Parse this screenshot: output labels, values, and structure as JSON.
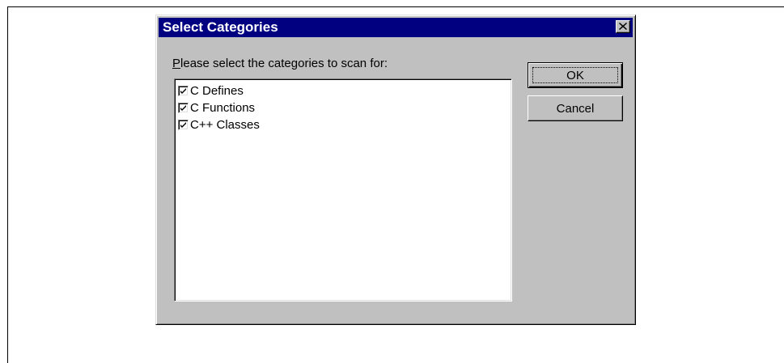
{
  "dialog": {
    "title": "Select Categories",
    "prompt": {
      "mnemonic": "P",
      "rest": "lease select the categories to scan for:"
    },
    "categories": [
      {
        "label": "C Defines",
        "checked": true
      },
      {
        "label": "C Functions",
        "checked": true
      },
      {
        "label": "C++ Classes",
        "checked": true
      }
    ],
    "buttons": {
      "ok_label": "OK",
      "cancel_label": "Cancel"
    }
  },
  "colors": {
    "titlebar": "#000080",
    "dialog_face": "#c0c0c0",
    "list_background": "#ffffff"
  }
}
